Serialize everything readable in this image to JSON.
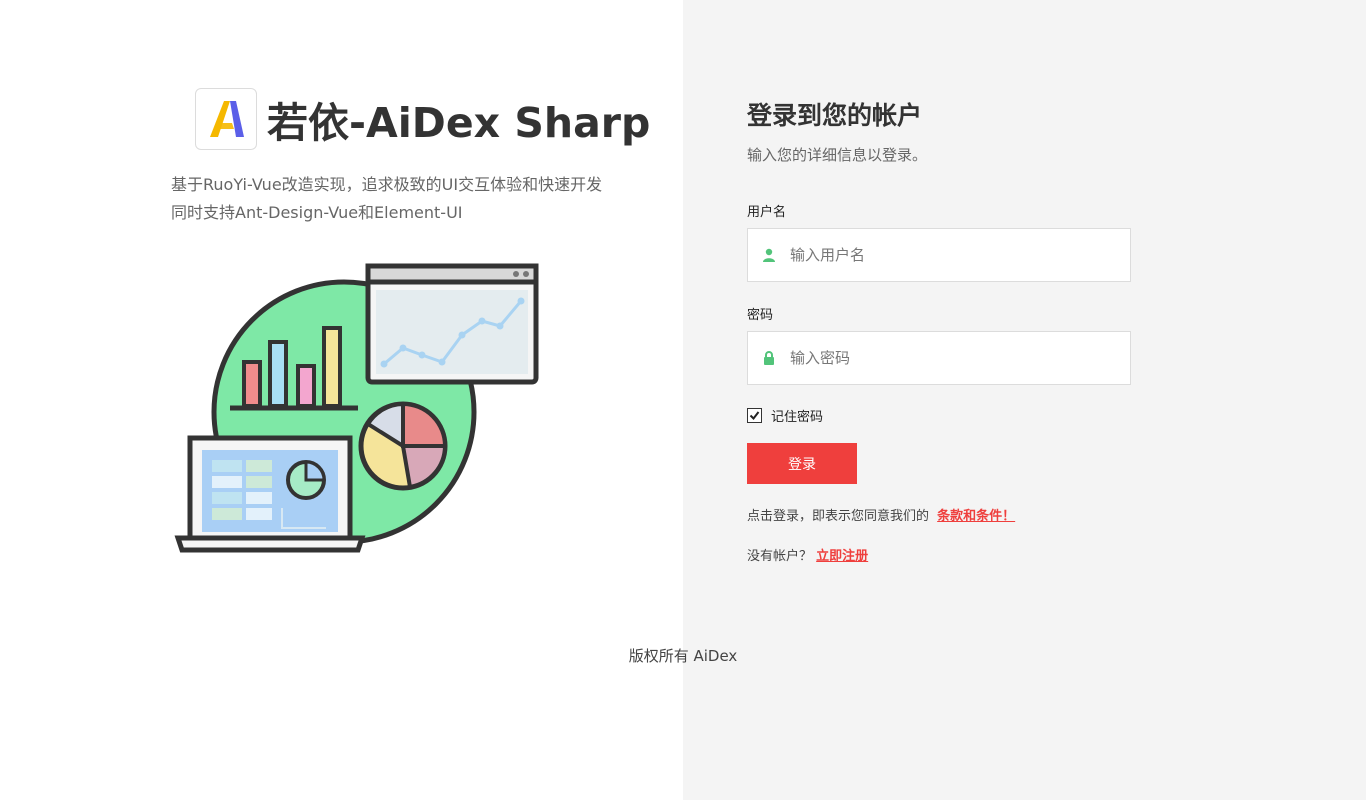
{
  "brand": {
    "title": "若依-AiDex Sharp",
    "intro_line1": "基于RuoYi-Vue改造实现，追求极致的UI交互体验和快速开发",
    "intro_line2": "同时支持Ant-Design-Vue和Element-UI",
    "logo_icon": "aidex-logo-icon",
    "illustration": "dashboard-analytics-illustration"
  },
  "login": {
    "title": "登录到您的帐户",
    "subtitle": "输入您的详细信息以登录。",
    "username_label": "用户名",
    "username_placeholder": "输入用户名",
    "username_icon": "user-icon",
    "password_label": "密码",
    "password_placeholder": "输入密码",
    "password_icon": "lock-icon",
    "remember_label": "记住密码",
    "remember_checked": true,
    "submit_label": "登录",
    "terms_text": "点击登录，即表示您同意我们的",
    "terms_link": "条款和条件！",
    "no_account_text": "没有帐户？",
    "register_link": "立即注册"
  },
  "footer": {
    "copyright": "版权所有 AiDex"
  },
  "colors": {
    "accent": "#ef3f3d",
    "icon_green": "#52c47a",
    "right_bg": "#f4f4f4"
  }
}
